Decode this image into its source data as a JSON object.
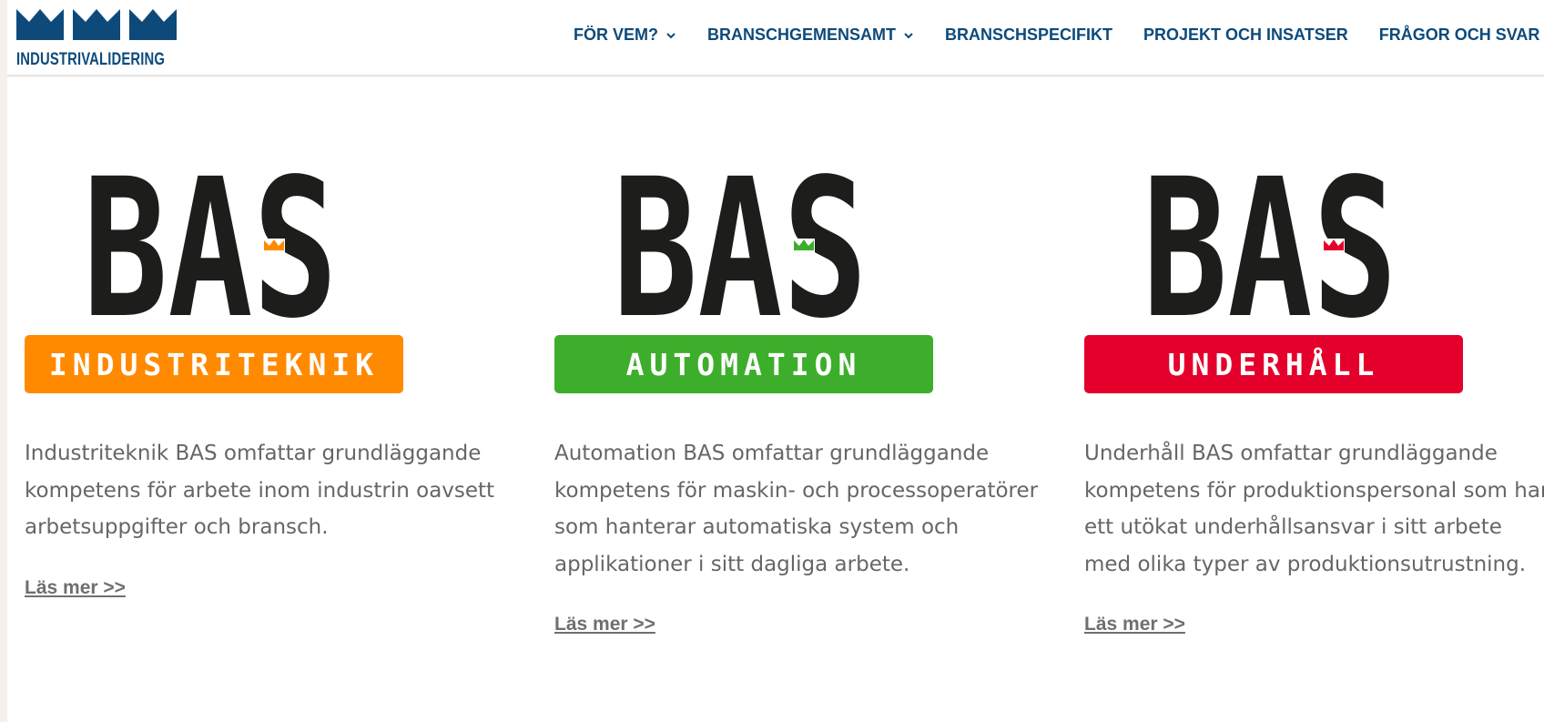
{
  "header": {
    "logo_text": "INDUSTRIVALIDERING",
    "brand_color": "#0d4a7a",
    "nav": [
      {
        "label": "FÖR VEM?",
        "has_dropdown": true
      },
      {
        "label": "BRANSCHGEMENSAMT",
        "has_dropdown": true
      },
      {
        "label": "BRANSCHSPECIFIKT",
        "has_dropdown": false
      },
      {
        "label": "PROJEKT OCH INSATSER",
        "has_dropdown": false
      },
      {
        "label": "FRÅGOR OCH SVAR",
        "has_dropdown": false
      }
    ]
  },
  "cards": [
    {
      "logo_word": "BAS",
      "badge_label": "INDUSTRITEKNIK",
      "accent": "#ff8a00",
      "description": "Industriteknik BAS omfattar grundläggande kompetens för arbete inom industrin oavsett arbetsuppgifter och bransch.",
      "link_label": "Läs mer >>"
    },
    {
      "logo_word": "BAS",
      "badge_label": "AUTOMATION",
      "accent": "#3dae2b",
      "description": "Automation BAS omfattar grundläggande kompetens för maskin- och processoperatörer som hanterar automatiska system och applikationer i sitt dagliga arbete.",
      "link_label": "Läs mer >>"
    },
    {
      "logo_word": "BAS",
      "badge_label": "UNDERHÅLL",
      "accent": "#e4002b",
      "description": "Underhåll BAS omfattar grundläggande kompetens för produktionspersonal som har ett utökat underhållsansvar i sitt arbete med olika typer av produktionsutrustning.",
      "link_label": "Läs mer >>"
    }
  ]
}
